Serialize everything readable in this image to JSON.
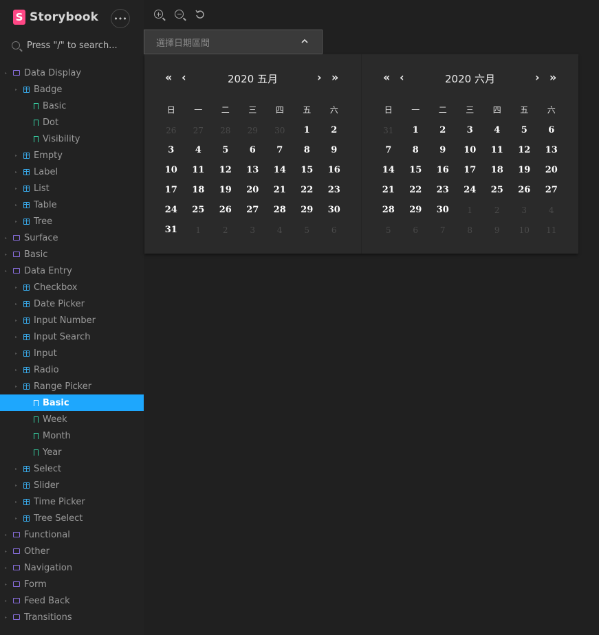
{
  "app": {
    "name": "Storybook",
    "logo_letter": "S",
    "menu": "•••"
  },
  "search": {
    "placeholder": "Press \"/\" to search..."
  },
  "tree": [
    {
      "label": "Data Display",
      "level": 0,
      "type": "folder"
    },
    {
      "label": "Badge",
      "level": 1,
      "type": "component"
    },
    {
      "label": "Basic",
      "level": 2,
      "type": "story"
    },
    {
      "label": "Dot",
      "level": 2,
      "type": "story"
    },
    {
      "label": "Visibility",
      "level": 2,
      "type": "story"
    },
    {
      "label": "Empty",
      "level": 1,
      "type": "component"
    },
    {
      "label": "Label",
      "level": 1,
      "type": "component"
    },
    {
      "label": "List",
      "level": 1,
      "type": "component"
    },
    {
      "label": "Table",
      "level": 1,
      "type": "component"
    },
    {
      "label": "Tree",
      "level": 1,
      "type": "component"
    },
    {
      "label": "Surface",
      "level": 0,
      "type": "folder"
    },
    {
      "label": "Basic",
      "level": 0,
      "type": "folder"
    },
    {
      "label": "Data Entry",
      "level": 0,
      "type": "folder"
    },
    {
      "label": "Checkbox",
      "level": 1,
      "type": "component"
    },
    {
      "label": "Date Picker",
      "level": 1,
      "type": "component"
    },
    {
      "label": "Input Number",
      "level": 1,
      "type": "component"
    },
    {
      "label": "Input Search",
      "level": 1,
      "type": "component"
    },
    {
      "label": "Input",
      "level": 1,
      "type": "component"
    },
    {
      "label": "Radio",
      "level": 1,
      "type": "component"
    },
    {
      "label": "Range Picker",
      "level": 1,
      "type": "component"
    },
    {
      "label": "Basic",
      "level": 2,
      "type": "story",
      "active": true
    },
    {
      "label": "Week",
      "level": 2,
      "type": "story"
    },
    {
      "label": "Month",
      "level": 2,
      "type": "story"
    },
    {
      "label": "Year",
      "level": 2,
      "type": "story"
    },
    {
      "label": "Select",
      "level": 1,
      "type": "component"
    },
    {
      "label": "Slider",
      "level": 1,
      "type": "component"
    },
    {
      "label": "Time Picker",
      "level": 1,
      "type": "component"
    },
    {
      "label": "Tree Select",
      "level": 1,
      "type": "component"
    },
    {
      "label": "Functional",
      "level": 0,
      "type": "folder"
    },
    {
      "label": "Other",
      "level": 0,
      "type": "folder"
    },
    {
      "label": "Navigation",
      "level": 0,
      "type": "folder"
    },
    {
      "label": "Form",
      "level": 0,
      "type": "folder"
    },
    {
      "label": "Feed Back",
      "level": 0,
      "type": "folder"
    },
    {
      "label": "Transitions",
      "level": 0,
      "type": "folder"
    }
  ],
  "toolbar": {
    "icons": [
      "zoom-in-icon",
      "zoom-out-icon",
      "reset-zoom-icon"
    ]
  },
  "range_input": {
    "placeholder": "選擇日期區間",
    "chevron": "^"
  },
  "calendar": {
    "nav": {
      "prev_year": "«",
      "prev_month": "‹",
      "next_month": "›",
      "next_year": "»"
    },
    "weekdays": [
      "日",
      "一",
      "二",
      "三",
      "四",
      "五",
      "六"
    ],
    "months": [
      {
        "title": "2020 五月",
        "weeks": [
          [
            {
              "d": "26",
              "dim": true
            },
            {
              "d": "27",
              "dim": true
            },
            {
              "d": "28",
              "dim": true
            },
            {
              "d": "29",
              "dim": true
            },
            {
              "d": "30",
              "dim": true
            },
            {
              "d": "1"
            },
            {
              "d": "2"
            }
          ],
          [
            {
              "d": "3"
            },
            {
              "d": "4"
            },
            {
              "d": "5"
            },
            {
              "d": "6"
            },
            {
              "d": "7"
            },
            {
              "d": "8"
            },
            {
              "d": "9"
            }
          ],
          [
            {
              "d": "10"
            },
            {
              "d": "11"
            },
            {
              "d": "12"
            },
            {
              "d": "13"
            },
            {
              "d": "14"
            },
            {
              "d": "15"
            },
            {
              "d": "16"
            }
          ],
          [
            {
              "d": "17"
            },
            {
              "d": "18"
            },
            {
              "d": "19"
            },
            {
              "d": "20"
            },
            {
              "d": "21"
            },
            {
              "d": "22"
            },
            {
              "d": "23"
            }
          ],
          [
            {
              "d": "24"
            },
            {
              "d": "25"
            },
            {
              "d": "26"
            },
            {
              "d": "27"
            },
            {
              "d": "28"
            },
            {
              "d": "29"
            },
            {
              "d": "30"
            }
          ],
          [
            {
              "d": "31"
            },
            {
              "d": "1",
              "dim": true
            },
            {
              "d": "2",
              "dim": true
            },
            {
              "d": "3",
              "dim": true
            },
            {
              "d": "4",
              "dim": true
            },
            {
              "d": "5",
              "dim": true
            },
            {
              "d": "6",
              "dim": true
            }
          ]
        ]
      },
      {
        "title": "2020 六月",
        "weeks": [
          [
            {
              "d": "31",
              "dim": true
            },
            {
              "d": "1"
            },
            {
              "d": "2"
            },
            {
              "d": "3"
            },
            {
              "d": "4"
            },
            {
              "d": "5"
            },
            {
              "d": "6"
            }
          ],
          [
            {
              "d": "7"
            },
            {
              "d": "8"
            },
            {
              "d": "9"
            },
            {
              "d": "10"
            },
            {
              "d": "11"
            },
            {
              "d": "12"
            },
            {
              "d": "13"
            }
          ],
          [
            {
              "d": "14"
            },
            {
              "d": "15"
            },
            {
              "d": "16"
            },
            {
              "d": "17"
            },
            {
              "d": "18"
            },
            {
              "d": "19"
            },
            {
              "d": "20"
            }
          ],
          [
            {
              "d": "21"
            },
            {
              "d": "22"
            },
            {
              "d": "23"
            },
            {
              "d": "24"
            },
            {
              "d": "25"
            },
            {
              "d": "26"
            },
            {
              "d": "27"
            }
          ],
          [
            {
              "d": "28"
            },
            {
              "d": "29"
            },
            {
              "d": "30"
            },
            {
              "d": "1",
              "dim": true
            },
            {
              "d": "2",
              "dim": true
            },
            {
              "d": "3",
              "dim": true
            },
            {
              "d": "4",
              "dim": true
            }
          ],
          [
            {
              "d": "5",
              "dim": true
            },
            {
              "d": "6",
              "dim": true
            },
            {
              "d": "7",
              "dim": true
            },
            {
              "d": "8",
              "dim": true
            },
            {
              "d": "9",
              "dim": true
            },
            {
              "d": "10",
              "dim": true
            },
            {
              "d": "11",
              "dim": true
            }
          ]
        ]
      }
    ]
  },
  "colors": {
    "accent": "#1ea7fd",
    "brand": "#ff4785",
    "folder": "#8a6fe0",
    "component": "#38a8e8",
    "story": "#37d5a6"
  }
}
